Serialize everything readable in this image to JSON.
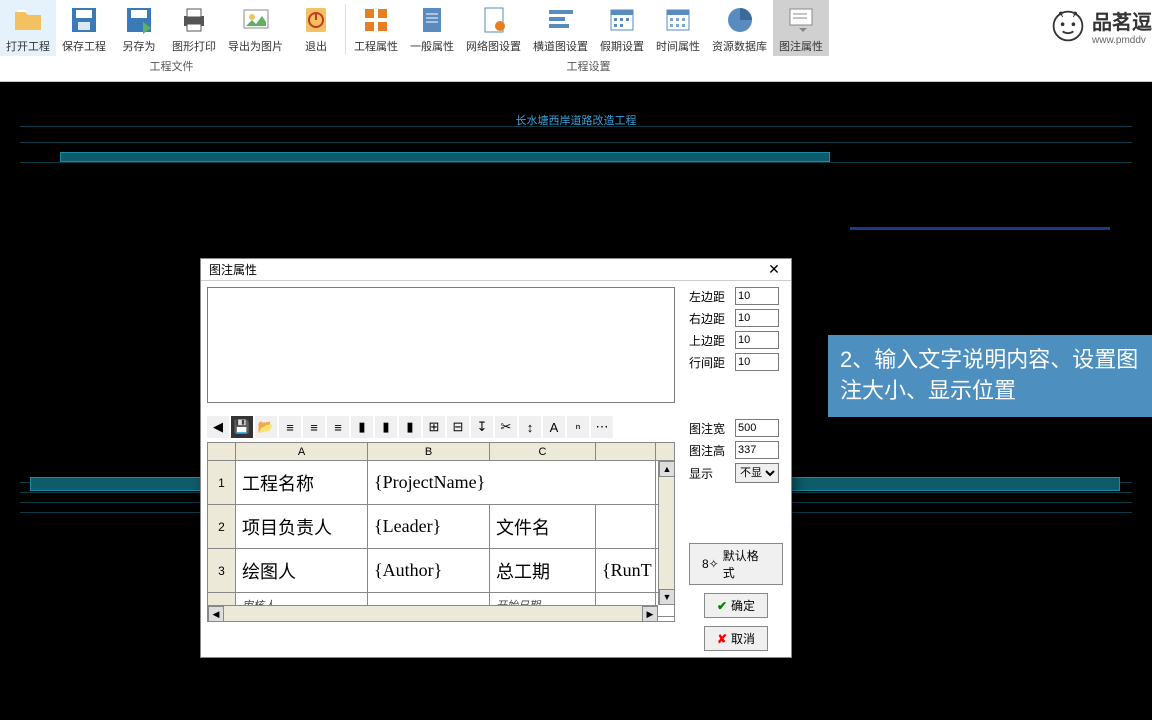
{
  "ribbon": {
    "open": "打开工程",
    "save": "保存工程",
    "saveas": "另存为",
    "print": "图形打印",
    "export": "导出为图片",
    "exit": "退出",
    "proj_prop": "工程属性",
    "gen_prop": "一般属性",
    "net_set": "网络图设置",
    "hdao_set": "横道图设置",
    "period_set": "假期设置",
    "time_prop": "时间属性",
    "res_db": "资源数据库",
    "legend_prop": "图注属性",
    "group_file": "工程文件",
    "group_set": "工程设置"
  },
  "logo": {
    "brand": "品茗逗",
    "url": "www.pmddv"
  },
  "gantt_title": "长水塘西岸道路改造工程",
  "dialog": {
    "title": "图注属性",
    "margins": {
      "left_lbl": "左边距",
      "left": "10",
      "right_lbl": "右边距",
      "right": "10",
      "top_lbl": "上边距",
      "top": "10",
      "line_lbl": "行间距",
      "line": "10"
    },
    "size": {
      "width_lbl": "图注宽",
      "width": "500",
      "height_lbl": "图注高",
      "height": "337",
      "show_lbl": "显示",
      "show": "不显"
    },
    "cols": [
      "A",
      "B",
      "C"
    ],
    "rows": [
      {
        "n": "1",
        "a": "工程名称",
        "b": "{ProjectName}",
        "c": ""
      },
      {
        "n": "2",
        "a": "项目负责人",
        "b": "{Leader}",
        "c": "文件名"
      },
      {
        "n": "3",
        "a": "绘图人",
        "b": "{Author}",
        "c": "总工期",
        "d": "{RunT"
      },
      {
        "n": "",
        "a": "审核人",
        "b": "",
        "c": "开始日期",
        "d": ""
      }
    ],
    "default_btn": "默认格式",
    "ok": "确定",
    "cancel": "取消"
  },
  "callout": "2、输入文字说明内容、设置图注大小、显示位置"
}
